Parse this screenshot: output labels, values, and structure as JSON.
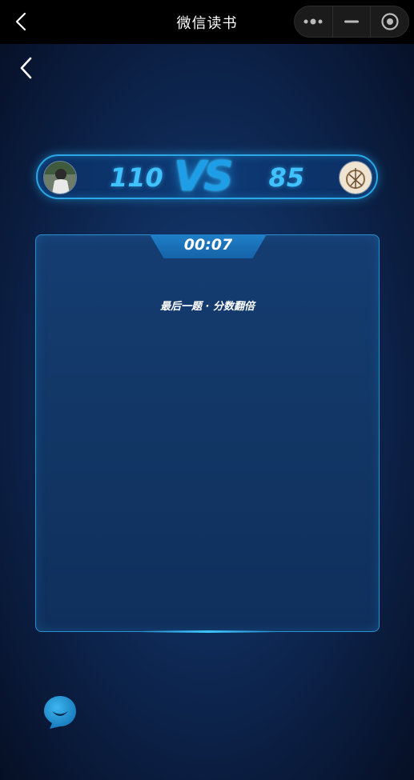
{
  "titlebar": {
    "title": "微信读书",
    "icons": [
      "back-icon",
      "more-dots-icon",
      "minimize-icon",
      "close-target-icon"
    ]
  },
  "battle": {
    "left_score": "110",
    "vs_label": "VS",
    "right_score": "85"
  },
  "quiz": {
    "timer": "00:07",
    "question_text": "最后一题 · 分数翻倍"
  },
  "colors": {
    "accent": "#3fc2ff",
    "vs": "#1e9ee6",
    "border": "#2aa8e8",
    "chat_button": "#1c8fcf"
  }
}
